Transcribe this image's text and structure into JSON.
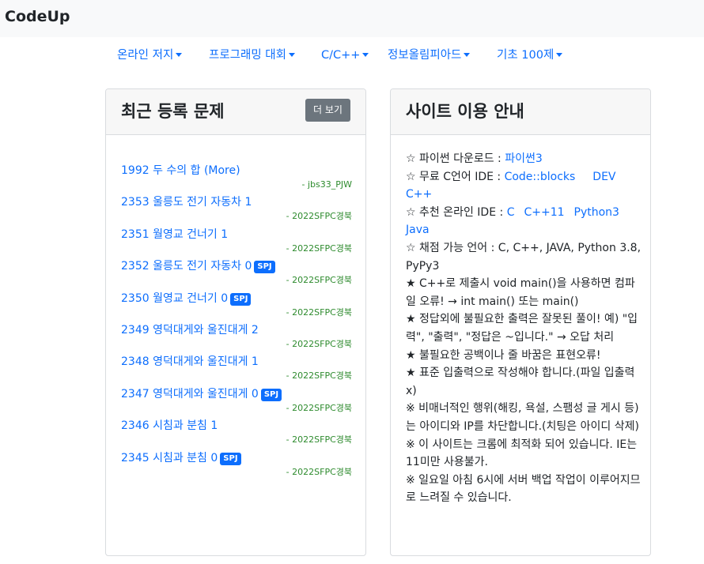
{
  "brand": "CodeUp",
  "nav": [
    {
      "label": "온라인 저지"
    },
    {
      "label": "프로그래밍 대회"
    },
    {
      "label": "C/C++"
    },
    {
      "label": "정보올림피아드"
    },
    {
      "label": "기초 100제"
    }
  ],
  "recent": {
    "title": "최근 등록 문제",
    "more_button": "더 보기",
    "problems": [
      {
        "title": "1992 두 수의 합 (More)",
        "author": "- jbs33_PJW",
        "badge": ""
      },
      {
        "title": "2353 울릉도 전기 자동차 1",
        "author": "- 2022SFPC경북",
        "badge": ""
      },
      {
        "title": "2351 월영교 건너기 1",
        "author": "- 2022SFPC경북",
        "badge": ""
      },
      {
        "title": "2352 울릉도 전기 자동차 0",
        "author": "- 2022SFPC경북",
        "badge": "SPJ"
      },
      {
        "title": "2350 월영교 건너기 0",
        "author": "- 2022SFPC경북",
        "badge": "SPJ"
      },
      {
        "title": "2349 영덕대게와 울진대게 2",
        "author": "- 2022SFPC경북",
        "badge": ""
      },
      {
        "title": "2348 영덕대게와 울진대게 1",
        "author": "- 2022SFPC경북",
        "badge": ""
      },
      {
        "title": "2347 영덕대게와 울진대게 0",
        "author": "- 2022SFPC경북",
        "badge": "SPJ"
      },
      {
        "title": "2346 시침과 분침 1",
        "author": "- 2022SFPC경북",
        "badge": ""
      },
      {
        "title": "2345 시침과 분침 0",
        "author": "- 2022SFPC경북",
        "badge": "SPJ"
      }
    ]
  },
  "guide": {
    "title": "사이트 이용 안내",
    "python_prefix": "☆ 파이썬 다운로드 : ",
    "python_link": "파이썬3",
    "ide_prefix": "☆ 무료 C언어 IDE : ",
    "ide_link1": "Code::blocks",
    "ide_link2": "DEV C++",
    "online_prefix": "☆ 추천 온라인 IDE : ",
    "online_links": [
      "C",
      "C++11",
      "Python3",
      "Java"
    ],
    "languages": "☆ 채점 가능 언어 : C, C++, JAVA, Python 3.8, PyPy3",
    "notes": [
      "★ C++로 제출시 void main()을 사용하면 컴파일 오류! → int main() 또는 main()",
      "★ 정답외에 불필요한 출력은 잘못된 풀이!  예) \"입력\", \"출력\", \"정답은 ~입니다.\" → 오답 처리",
      "★ 불필요한 공백이나 줄 바꿈은 표현오류!",
      "★ 표준 입출력으로 작성해야 합니다.(파일 입출력 x)",
      "※ 비매너적인 행위(해킹, 욕설, 스팸성 글 게시 등)는 아이디와 IP를 차단합니다.(치팅은 아이디 삭제)",
      "※ 이 사이트는 크롬에 최적화 되어 있습니다. IE는 11미만 사용불가.",
      "※ 일요일 아침 6시에 서버 백업 작업이 이루어지므로 느려질 수 있습니다."
    ]
  }
}
